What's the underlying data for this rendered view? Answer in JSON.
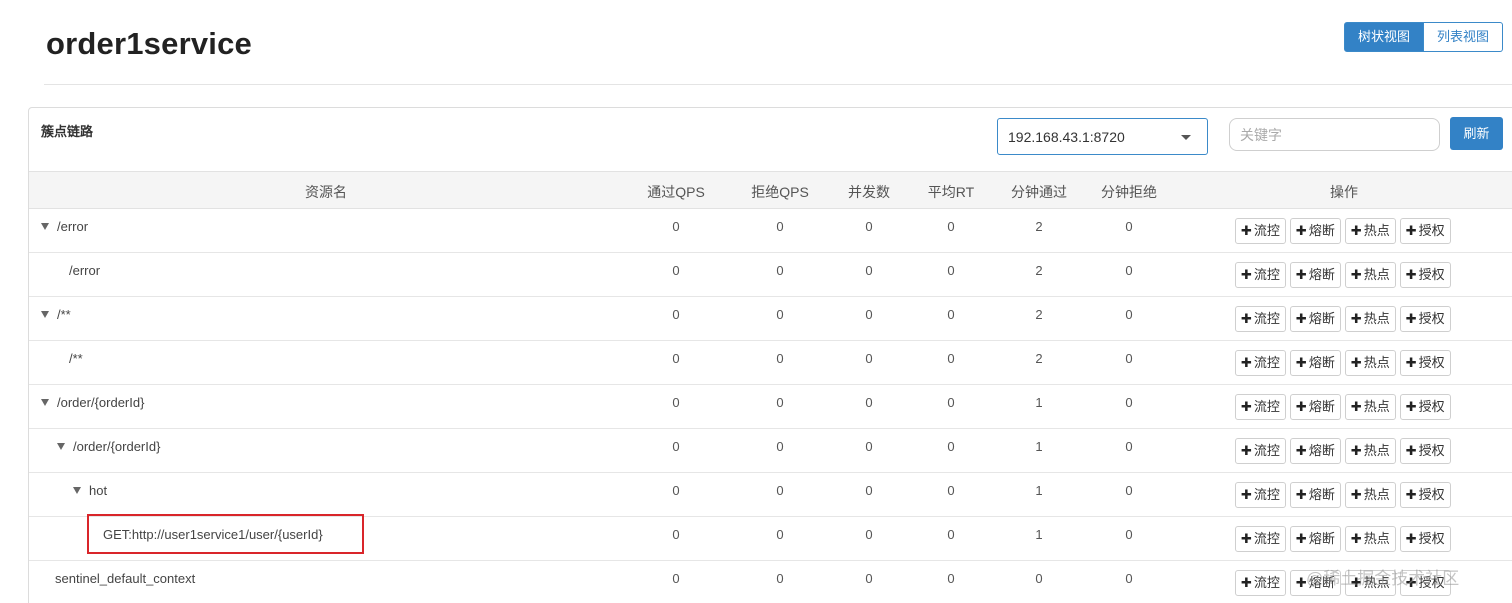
{
  "header": {
    "title": "order1service",
    "view_tree_label": "树状视图",
    "view_list_label": "列表视图"
  },
  "panel": {
    "title": "簇点链路",
    "machine_select_value": "192.168.43.1:8720",
    "search_placeholder": "关键字",
    "refresh_label": "刷新"
  },
  "table": {
    "columns": [
      "资源名",
      "通过QPS",
      "拒绝QPS",
      "并发数",
      "平均RT",
      "分钟通过",
      "分钟拒绝",
      "操作"
    ],
    "actions": [
      "流控",
      "熔断",
      "热点",
      "授权"
    ],
    "rows": [
      {
        "name": "/error",
        "expand": "▼",
        "pass_qps": "0",
        "block_qps": "0",
        "threads": "0",
        "avg_rt": "0",
        "min_pass": "2",
        "min_block": "0"
      },
      {
        "name": "/error",
        "expand": "",
        "pass_qps": "0",
        "block_qps": "0",
        "threads": "0",
        "avg_rt": "0",
        "min_pass": "2",
        "min_block": "0"
      },
      {
        "name": "/**",
        "expand": "▼",
        "pass_qps": "0",
        "block_qps": "0",
        "threads": "0",
        "avg_rt": "0",
        "min_pass": "2",
        "min_block": "0"
      },
      {
        "name": "/**",
        "expand": "",
        "pass_qps": "0",
        "block_qps": "0",
        "threads": "0",
        "avg_rt": "0",
        "min_pass": "2",
        "min_block": "0"
      },
      {
        "name": "/order/{orderId}",
        "expand": "▼",
        "pass_qps": "0",
        "block_qps": "0",
        "threads": "0",
        "avg_rt": "0",
        "min_pass": "1",
        "min_block": "0"
      },
      {
        "name": "/order/{orderId}",
        "expand": "▼",
        "pass_qps": "0",
        "block_qps": "0",
        "threads": "0",
        "avg_rt": "0",
        "min_pass": "1",
        "min_block": "0"
      },
      {
        "name": "hot",
        "expand": "▼",
        "pass_qps": "0",
        "block_qps": "0",
        "threads": "0",
        "avg_rt": "0",
        "min_pass": "1",
        "min_block": "0"
      },
      {
        "name": "GET:http://user1service1/user/{userId}",
        "expand": "",
        "pass_qps": "0",
        "block_qps": "0",
        "threads": "0",
        "avg_rt": "0",
        "min_pass": "1",
        "min_block": "0",
        "highlighted": true
      },
      {
        "name": "sentinel_default_context",
        "expand": "",
        "pass_qps": "0",
        "block_qps": "0",
        "threads": "0",
        "avg_rt": "0",
        "min_pass": "0",
        "min_block": "0"
      }
    ]
  },
  "watermark": "@稀土掘金技术社区",
  "colors": {
    "primary": "#3382c6",
    "highlight": "#d9252a"
  }
}
